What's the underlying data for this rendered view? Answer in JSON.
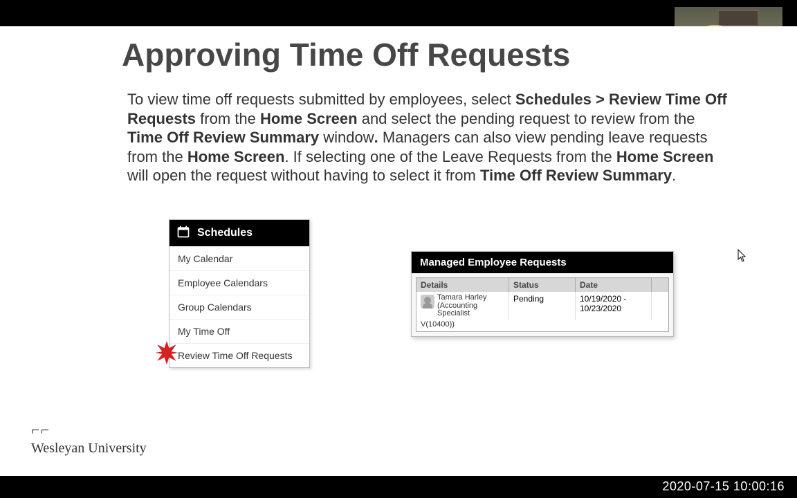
{
  "title": "Approving Time Off Requests",
  "body": {
    "pre1": "To view time off requests submitted by employees, select ",
    "b1": "Schedules > Review Time Off Requests",
    "t2": " from the ",
    "b2": "Home Screen",
    "t3": " and select the pending request to review from the ",
    "b3": "Time Off Review Summary",
    "t4": " window",
    "dot": ".",
    "t5": " Managers can also view pending leave requests from the ",
    "b4": "Home Screen",
    "t6": ".  If selecting one of the Leave Requests from the ",
    "b5": "Home Screen",
    "t7": " will open the request without having to select it from ",
    "b6": "Time Off Review Summary",
    "t8": "."
  },
  "schedules": {
    "header": "Schedules",
    "items": [
      "My Calendar",
      "Employee Calendars",
      "Group Calendars",
      "My Time Off",
      "Review Time Off Requests"
    ]
  },
  "mer": {
    "header": "Managed Employee Requests",
    "columns": [
      "Details",
      "Status",
      "Date"
    ],
    "row": {
      "name": "Tamara Harley",
      "role": "(Accounting Specialist",
      "tail": "V(10400))",
      "status": "Pending",
      "date": "10/19/2020 - 10/23/2020"
    }
  },
  "logo": {
    "mark": "⌐ ⌐",
    "name": "Wesleyan University"
  },
  "timestamp": "2020-07-15 10:00:16"
}
